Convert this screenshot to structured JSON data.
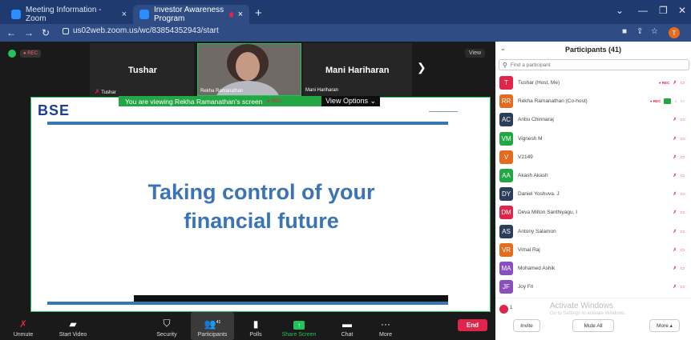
{
  "browser": {
    "tabs": [
      {
        "title": "Meeting Information - Zoom",
        "close": "×"
      },
      {
        "title": "Investor Awareness Program",
        "close": "×"
      }
    ],
    "new_tab": "+",
    "url": "us02web.zoom.us/wc/83854352943/start"
  },
  "meeting": {
    "rec_label": "● REC",
    "view_label": "View",
    "tiles": [
      {
        "name": "Tushar",
        "label": "Tushar"
      },
      {
        "name": "",
        "label": "Rekha Ramanathan"
      },
      {
        "name": "Mani Hariharan",
        "label": "Mani Hariharan"
      }
    ],
    "banner_text": "You are viewing Rekha Ramanathan's screen",
    "banner_rec": "● REC",
    "view_options": "View Options ⌄",
    "slide": {
      "logo": "BSE",
      "title_line1": "Taking control of your",
      "title_line2": "financial future"
    }
  },
  "toolbar": {
    "unmute": "Unmute",
    "start_video": "Start Video",
    "security": "Security",
    "participants": "Participants",
    "participants_count": "41",
    "polls": "Polls",
    "share_screen": "Share Screen",
    "chat": "Chat",
    "more": "More",
    "end": "End"
  },
  "panel": {
    "title": "Participants (41)",
    "search_placeholder": "Find a participant",
    "participants": [
      {
        "initials": "T",
        "name": "Tushar (Host, Me)",
        "color": "#e0244a"
      },
      {
        "initials": "RR",
        "name": "Rekha Ramanathan (Co-host)",
        "color": "#e56b1f"
      },
      {
        "initials": "AC",
        "name": "Anbu Chinnaraj",
        "color": "#2c3e5a"
      },
      {
        "initials": "VM",
        "name": "Vignesh M",
        "color": "#23a644"
      },
      {
        "initials": "V",
        "name": "V2149",
        "color": "#e56b1f"
      },
      {
        "initials": "AA",
        "name": "Akash Akash",
        "color": "#23a644"
      },
      {
        "initials": "DY",
        "name": "Daniel Yoshuva. J",
        "color": "#2c3e5a"
      },
      {
        "initials": "DM",
        "name": "Deva Milton Santhiyagu. I",
        "color": "#e0244a"
      },
      {
        "initials": "AS",
        "name": "Antony Salamon",
        "color": "#2c3e5a"
      },
      {
        "initials": "VR",
        "name": "Vimal Raj",
        "color": "#e56b1f"
      },
      {
        "initials": "MA",
        "name": "Mohamed Ashik",
        "color": "#8a4fbf"
      },
      {
        "initials": "JF",
        "name": "Joy Fri",
        "color": "#8a4fbf"
      }
    ],
    "rec_small": "● REC",
    "footer": {
      "count": "1",
      "activate_title": "Activate Windows",
      "activate_sub": "Go to Settings to activate Windows.",
      "invite": "Invite",
      "mute_all": "Mute All",
      "more": "More ▴"
    }
  }
}
